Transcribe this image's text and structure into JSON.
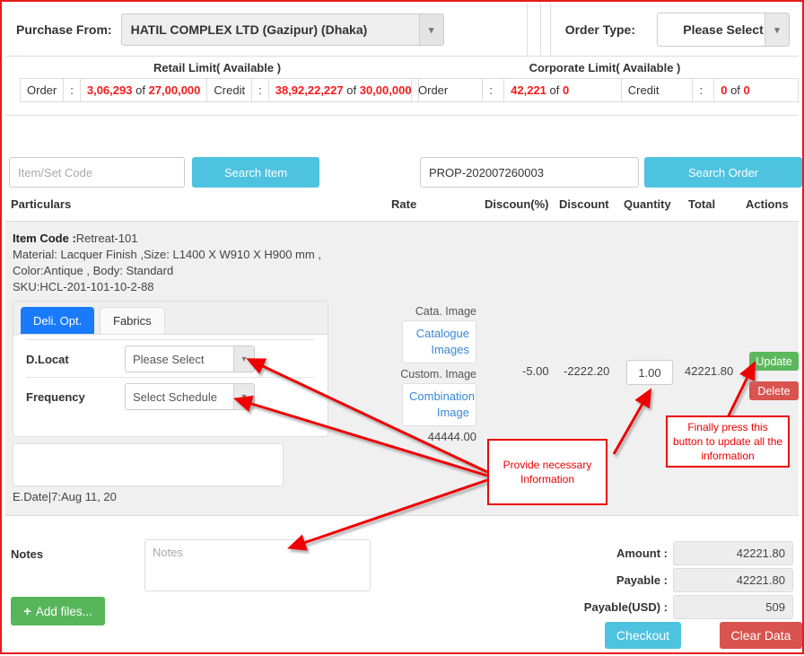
{
  "header": {
    "purchase_from_label": "Purchase From:",
    "vendor_value": "HATIL COMPLEX LTD (Gazipur) (Dhaka)",
    "order_type_label": "Order Type:",
    "order_type_value": "Please Select"
  },
  "limits": {
    "retail_title": "Retail Limit( Available )",
    "corporate_title": "Corporate Limit( Available )",
    "retail": {
      "order_label": "Order",
      "colon": ":",
      "order_used": "3,06,293",
      "of": "of",
      "order_total": "27,00,000",
      "credit_label": "Credit",
      "credit_used": "38,92,22,227",
      "credit_total": "30,00,000"
    },
    "corporate": {
      "order_label": "Order",
      "colon": ":",
      "order_used": "42,221",
      "of": "of",
      "order_total": "0",
      "credit_label": "Credit",
      "credit_used": "0",
      "credit_total": "0"
    }
  },
  "search": {
    "item_placeholder": "Item/Set Code",
    "item_value": "",
    "search_item_label": "Search Item",
    "order_value": "PROP-202007260003",
    "search_order_label": "Search Order"
  },
  "table_headers": {
    "particulars": "Particulars",
    "rate": "Rate",
    "discount_pct": "Discoun(%)",
    "discount": "Discount",
    "quantity": "Quantity",
    "total": "Total",
    "actions": "Actions"
  },
  "item": {
    "code_label": "Item Code :",
    "code_value": "Retreat-101",
    "material_line": "Material: Lacquer Finish ,Size: L1400 X W910 X H900 mm ,",
    "color_line": "Color:Antique , Body: Standard",
    "sku_line": "SKU:HCL-201-101-10-2-88",
    "tabs": [
      {
        "label": "Deli. Opt.",
        "active": true
      },
      {
        "label": "Fabrics",
        "active": false
      }
    ],
    "fields": [
      {
        "label": "D.Locat",
        "value": "Please Select"
      },
      {
        "label": "Frequency",
        "value": "Select Schedule"
      }
    ],
    "memo_value": "",
    "edate": "E.Date|7:Aug 11, 20",
    "cata_image_label": "Cata. Image",
    "catalogue_button": "Catalogue Images",
    "custom_image_label": "Custom. Image",
    "combination_button": "Combination Image",
    "rate": "44444.00",
    "discount_pct": "-5.00",
    "discount": "-2222.20",
    "quantity": "1.00",
    "total": "42221.80",
    "update_label": "Update",
    "delete_label": "Delete"
  },
  "footer": {
    "notes_label": "Notes",
    "notes_placeholder": "Notes",
    "notes_value": "",
    "add_files_label": "Add files...",
    "add_files_icon": "plus-icon",
    "totals": [
      {
        "label": "Amount :",
        "value": "42221.80"
      },
      {
        "label": "Payable :",
        "value": "42221.80"
      },
      {
        "label": "Payable(USD) :",
        "value": "509"
      }
    ],
    "checkout_label": "Checkout",
    "clear_data_label": "Clear Data"
  },
  "annotations": [
    {
      "id": "provide-info",
      "text": "Provide necessary Information"
    },
    {
      "id": "press-update",
      "text": "Finally press this button to update all the information"
    }
  ],
  "colors": {
    "accent_blue": "#4ec3e0",
    "tab_blue": "#1a7afc",
    "green": "#5cb85c",
    "red": "#d9534f",
    "annotation_red": "#ee0000",
    "limit_red": "#f51b1b"
  }
}
